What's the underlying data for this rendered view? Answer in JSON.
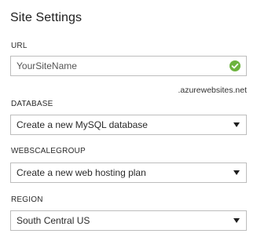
{
  "panel": {
    "title": "Site Settings"
  },
  "url": {
    "label": "URL",
    "value": "YourSiteName",
    "suffix": ".azurewebsites.net",
    "status_icon": "check-circle-icon",
    "status_color": "#6cb33e"
  },
  "database": {
    "label": "DATABASE",
    "selected": "Create a new MySQL database"
  },
  "webscalegroup": {
    "label": "WEBSCALEGROUP",
    "selected": "Create a new web hosting plan"
  },
  "region": {
    "label": "REGION",
    "selected": "South Central US"
  }
}
